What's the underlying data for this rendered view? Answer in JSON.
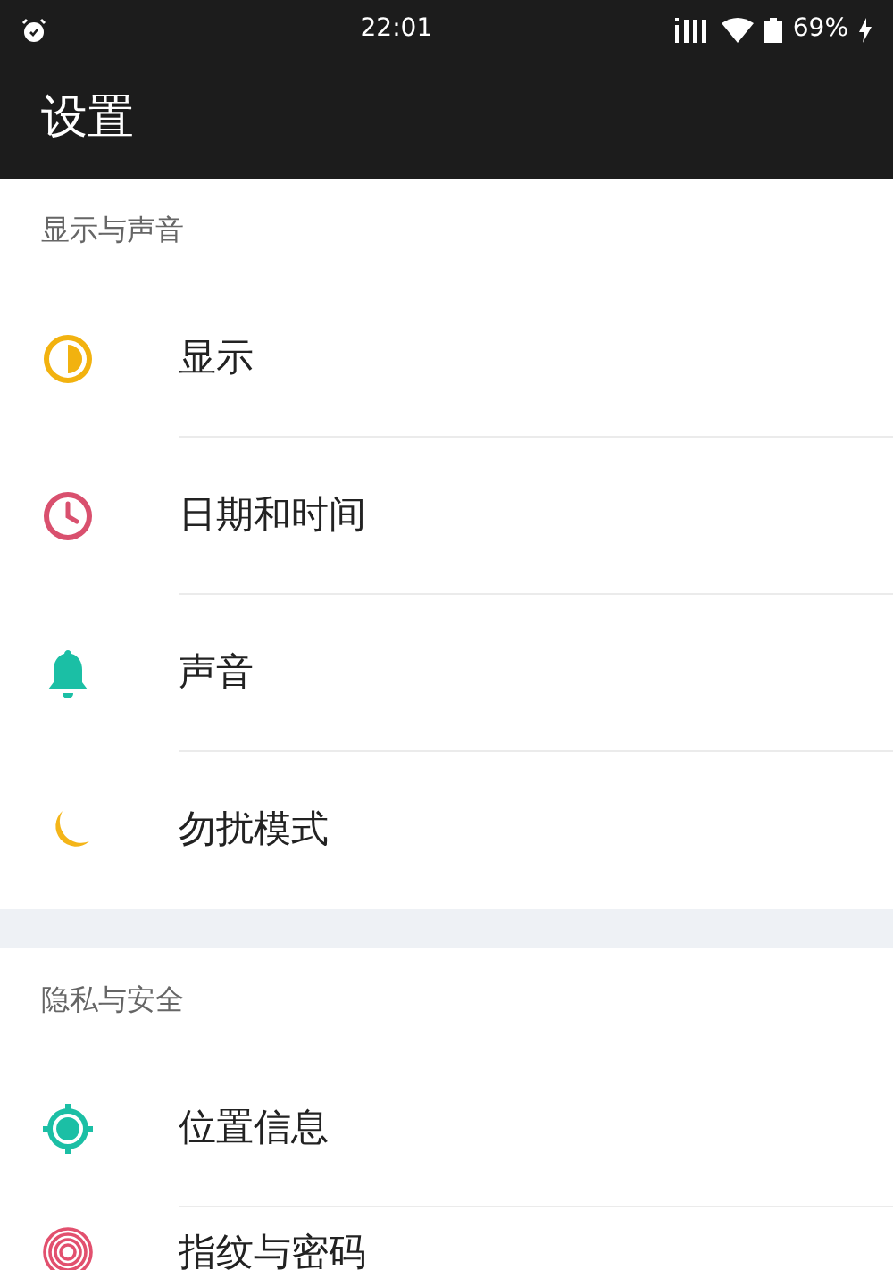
{
  "status_bar": {
    "time": "22:01",
    "battery": "69%"
  },
  "header": {
    "title": "设置"
  },
  "sections": [
    {
      "title": "显示与声音",
      "items": [
        {
          "label": "显示",
          "kind": "contrast"
        },
        {
          "label": "日期和时间",
          "kind": "clock"
        },
        {
          "label": "声音",
          "kind": "bell"
        },
        {
          "label": "勿扰模式",
          "kind": "moon"
        }
      ]
    },
    {
      "title": "隐私与安全",
      "items": [
        {
          "label": "位置信息",
          "kind": "location"
        },
        {
          "label": "指纹与密码",
          "kind": "fingerprint"
        }
      ]
    }
  ]
}
